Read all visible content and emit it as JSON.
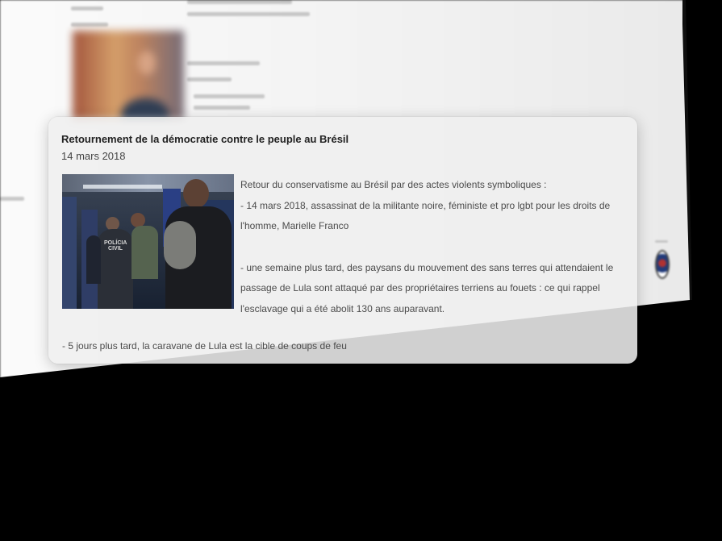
{
  "card": {
    "title": "Retournement de la démocratie contre le peuple au Brésil",
    "date": "14 mars 2018",
    "photo_caption": "POLÍCIA CIVIL",
    "body_intro": "Retour du conservatisme au Brésil par des actes violents symboliques :",
    "body_item_1": " - 14 mars 2018, assassinat de la militante noire, féministe et pro lgbt pour les droits de l'homme, Marielle Franco",
    "body_item_2": "- une semaine plus tard, des paysans du mouvement des sans terres qui attendaient le passage de Lula sont attaqué par des propriétaires terriens au fouets : ce qui rappel l'esclavage qui a été abolit 130 ans auparavant.",
    "body_item_3": "- 5 jours plus tard, la caravane de Lula est la cible de coups de feu"
  }
}
